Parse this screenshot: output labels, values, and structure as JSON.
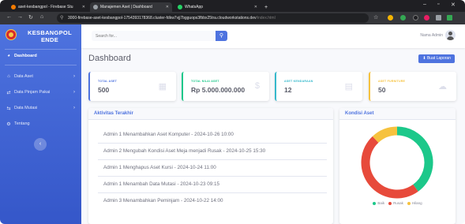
{
  "browser": {
    "tabs": [
      {
        "title": "aset-kesbangpol - Firebase Stu",
        "color": "#f57c00"
      },
      {
        "title": "Manajemen Aset | Dashboard",
        "color": "#9aa0a6"
      },
      {
        "title": "WhatsApp",
        "color": "#25d366"
      }
    ],
    "new_tab": "+",
    "url_main": "3000-firebase-aset-kesbangpol-1754393178368.cluster-fdkw7vjj7bgguops3fbbx25tra.cloudworkstations.dev",
    "url_path": "/index.html"
  },
  "sidebar": {
    "brand": "KESBANGPOL ENDE",
    "items": [
      {
        "label": "Dashboard",
        "icon": "dashboard-icon",
        "active": true
      },
      {
        "label": "Data Aset",
        "icon": "home-icon",
        "chevron": "›"
      },
      {
        "label": "Data Pinjam Pakai",
        "icon": "exchange-icon",
        "chevron": "›"
      },
      {
        "label": "Data Mutasi",
        "icon": "transfer-icon",
        "chevron": "›"
      },
      {
        "label": "Tentang",
        "icon": "gear-icon"
      }
    ],
    "toggle": "‹"
  },
  "topbar": {
    "search_placeholder": "Search for...",
    "user": "Nama Admin"
  },
  "page": {
    "title": "Dashboard",
    "report_button": "⬇ Buat Laporan"
  },
  "stats": [
    {
      "label": "Total Aset",
      "value": "500",
      "color": "#4e73df",
      "icon": "calendar-icon"
    },
    {
      "label": "Total Nilai Aset",
      "value": "Rp 5.000.000.000",
      "color": "#1cc88a",
      "icon": "dollar-icon"
    },
    {
      "label": "Aset Kendaraan",
      "value": "12",
      "color": "#36b9cc",
      "icon": "clipboard-icon"
    },
    {
      "label": "Aset Furniture",
      "value": "50",
      "color": "#f6c23e",
      "icon": "comments-icon"
    }
  ],
  "activity": {
    "title": "Aktivitas Terakhir",
    "items": [
      "Admin 1 Menambahkan Aset Komputer - 2024-10-26 10:00",
      "Admin 2 Mengubah Kondisi Aset Meja menjadi Rusak - 2024-10-25 15:30",
      "Admin 1 Menghapus Aset Kursi - 2024-10-24 11:00",
      "Admin 1 Menambah Data Mutasi - 2024-10-23 09:15",
      "Admin 3 Menambahkan Peminjam - 2024-10-22 14:00"
    ]
  },
  "chart_data": {
    "type": "pie",
    "title": "Kondisi Aset",
    "categories": [
      "Baik",
      "Rusak",
      "Hilang"
    ],
    "values": [
      40,
      48,
      12
    ],
    "colors": [
      "#1cc88a",
      "#e74a3b",
      "#f6c23e"
    ],
    "legend": "bottom"
  }
}
